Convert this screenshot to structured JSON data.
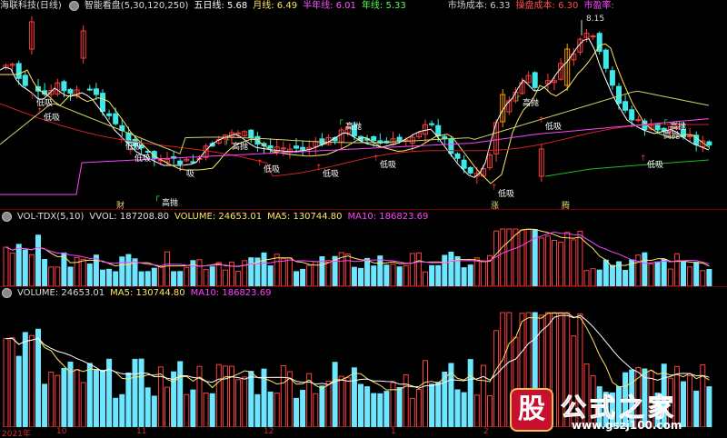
{
  "colors": {
    "up": "#ff3c3c",
    "down": "#3ee8e8",
    "ma5": "#ffffff",
    "ma10": "#ffe666",
    "ma20": "#ff44ff",
    "ma60": "#c8242a",
    "ma120": "#d4d06a",
    "ma250": "#22bb22",
    "vol_up_fill": "#00000000",
    "vol_up_stroke": "#ff4040",
    "vol_down": "#6ee6ff"
  },
  "header": {
    "title": "海联科技(日线)",
    "indicator": "智能看盘(5,30,120,250)",
    "ma5": "五日线: 5.68",
    "month": "月线: 6.49",
    "half": "半年线: 6.01",
    "year": "年线: 5.33",
    "cost": "市场成本: 6.33",
    "trap": "操盘成本: 6.30",
    "pe": "市盈率:"
  },
  "main": {
    "price_label": "8.15",
    "signals": [
      {
        "t": "低吸",
        "c": "#fff"
      },
      {
        "t": "高抛",
        "c": "#fff"
      },
      {
        "t": "低吸",
        "c": "#fff"
      },
      {
        "t": "吸",
        "c": "#fff"
      },
      {
        "t": "低吸",
        "c": "#fff"
      },
      {
        "t": "低吸",
        "c": "#fff"
      },
      {
        "t": "低吸",
        "c": "#fff"
      },
      {
        "t": "高抛",
        "c": "#fff"
      },
      {
        "t": "低吸",
        "c": "#fff"
      },
      {
        "t": "高抛",
        "c": "#fff"
      },
      {
        "t": "低吸",
        "c": "#fff"
      },
      {
        "t": "高抛",
        "c": "#fff"
      },
      {
        "t": "低吸",
        "c": "#fff"
      },
      {
        "t": "低吸",
        "c": "#fff"
      },
      {
        "t": "高抛",
        "c": "#fff"
      },
      {
        "t": "低吸",
        "c": "#fff"
      },
      {
        "t": "高抛",
        "c": "#fff"
      }
    ],
    "badges": [
      "财",
      "涨",
      "腾"
    ]
  },
  "vol_tdx": {
    "name": "VOL-TDX(5,10)",
    "vvol": "VVOL: 187208.80",
    "volume": "VOLUME: 24653.01",
    "ma5": "MA5: 130744.80",
    "ma10": "MA10: 186823.69"
  },
  "volume": {
    "volume": "VOLUME: 24653.01",
    "ma5": "MA5: 130744.80",
    "ma10": "MA10: 186823.69"
  },
  "axis": [
    "2021年",
    "10",
    "11",
    "12",
    "1",
    "2"
  ],
  "watermark": {
    "badge": "股",
    "title": "公式之家",
    "url": "www.gszj100.com"
  }
}
